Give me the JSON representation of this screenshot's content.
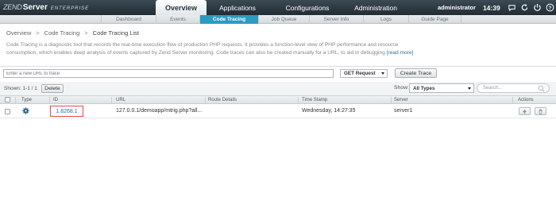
{
  "header": {
    "logo_zend": "ZEND",
    "logo_server": "Server",
    "logo_edition": "ENTERPRISE",
    "nav": [
      {
        "label": "Overview",
        "active": true
      },
      {
        "label": "Applications",
        "active": false
      },
      {
        "label": "Configurations",
        "active": false
      },
      {
        "label": "Administration",
        "active": false
      }
    ],
    "user": "administrator",
    "clock": "14:39",
    "icons": [
      "notifications-icon",
      "refresh-icon",
      "logout-icon",
      "help-icon"
    ]
  },
  "subnav": {
    "tabs": [
      {
        "label": "Dashboard",
        "active": false
      },
      {
        "label": "Events",
        "active": false
      },
      {
        "label": "Code Tracing",
        "active": true
      },
      {
        "label": "Job Queue",
        "active": false
      },
      {
        "label": "Server Info",
        "active": false
      },
      {
        "label": "Logs",
        "active": false
      },
      {
        "label": "Guide Page",
        "active": false
      }
    ]
  },
  "breadcrumb": [
    "Overview",
    "Code Tracing",
    "Code Tracing List"
  ],
  "description": {
    "text": "Code Tracing is a diagnostic tool that records the real-time execution flow of production PHP requests. It provides a function-level view of PHP performance and resource consumption, which enables deep analysis of events captured by Zend Server monitoring. Code traces can also be created manually for a URL, to aid in debugging ",
    "link": "[read more]"
  },
  "trace_form": {
    "url_placeholder": "Enter a new URL to trace",
    "method_value": "GET Request",
    "create_label": "Create Trace"
  },
  "list_toolbar": {
    "shown": "Shown: 1-1 / 1",
    "delete_label": "Delete",
    "show_label": "Show:",
    "show_value": "All Types",
    "search_placeholder": "Search..."
  },
  "table": {
    "columns": [
      "Type",
      "ID",
      "URL",
      "Route Details",
      "Time Stamp",
      "Server",
      "Actions"
    ],
    "rows": [
      {
        "type_icon": "gear-icon",
        "id": "1.8268.1",
        "url": "127.0.0.1/demoapp/mtrig.php?all...",
        "route": "",
        "timestamp": "Wednesday, 14:27:35",
        "server": "server1"
      }
    ]
  },
  "colors": {
    "topbar": "#2c3840",
    "active_subtab": "#2b9bc1",
    "link": "#2a6ea5",
    "highlight_border": "#e34b4b"
  }
}
